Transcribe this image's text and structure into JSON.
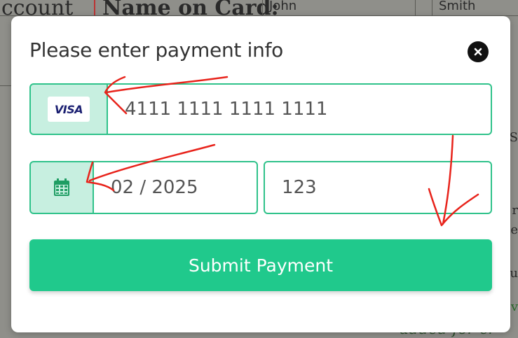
{
  "background": {
    "frag_account": "ccount",
    "frag_name_label": "Name on Card:",
    "frag_first": "John",
    "frag_last": "Smith",
    "frag_right_1": "S",
    "frag_right_2": "r",
    "frag_right_3": "te",
    "frag_right_4": "u",
    "frag_right_5": "v",
    "frag_bottom": "added for cr"
  },
  "modal": {
    "title": "Please enter payment info",
    "close_icon": "close-icon"
  },
  "card": {
    "brand": "VISA",
    "number": "4111 1111 1111 1111"
  },
  "expiry": {
    "icon": "calendar-icon",
    "value": "02 / 2025"
  },
  "cvv": {
    "value": "123"
  },
  "submit": {
    "label": "Submit Payment"
  },
  "colors": {
    "accent": "#20c98c",
    "border": "#2fc28a",
    "addon_bg": "#c7efe0",
    "annotation": "#e8231b"
  }
}
